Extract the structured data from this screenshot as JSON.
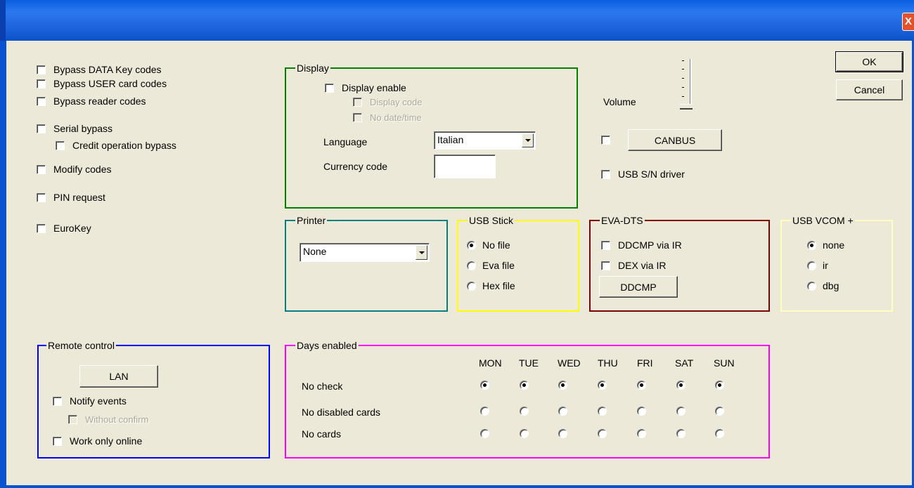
{
  "window": {
    "close_glyph": "X"
  },
  "buttons": {
    "ok": "OK",
    "cancel": "Cancel",
    "canbus": "CANBUS",
    "ddcmp": "DDCMP",
    "lan": "LAN"
  },
  "bypass": [
    {
      "label": "Bypass DATA Key codes",
      "checked": false
    },
    {
      "label": "Bypass USER card codes",
      "checked": false
    },
    {
      "label": "Bypass reader codes",
      "checked": false
    },
    {
      "label": "Serial bypass",
      "checked": false
    },
    {
      "label": "Credit operation bypass",
      "checked": false
    },
    {
      "label": "Modify codes",
      "checked": false
    },
    {
      "label": "PIN request",
      "checked": false
    },
    {
      "label": "EuroKey",
      "checked": false
    }
  ],
  "display": {
    "group_label": "Display",
    "enable_label": "Display enable",
    "display_code_label": "Display code",
    "no_datetime_label": "No date/time",
    "language_label": "Language",
    "language_value": "Italian",
    "currency_label": "Currency code",
    "currency_value": ""
  },
  "volume": {
    "label": "Volume",
    "level": 1.0
  },
  "canbus_check": false,
  "usb_sn": {
    "label": "USB S/N driver",
    "checked": false
  },
  "printer": {
    "group_label": "Printer",
    "value": "None"
  },
  "usb_stick": {
    "group_label": "USB Stick",
    "options": [
      "No file",
      "Eva file",
      "Hex file"
    ],
    "selected": "No file"
  },
  "eva_dts": {
    "group_label": "EVA-DTS",
    "ddcmp_ir_label": "DDCMP via IR",
    "dex_ir_label": "DEX via IR"
  },
  "usb_vcom": {
    "group_label": "USB VCOM +",
    "options": [
      "none",
      "ir",
      "dbg"
    ],
    "selected": "none"
  },
  "remote": {
    "group_label": "Remote control",
    "notify_label": "Notify events",
    "without_confirm_label": "Without confirm",
    "work_online_label": "Work only online"
  },
  "days": {
    "group_label": "Days enabled",
    "columns": [
      "MON",
      "TUE",
      "WED",
      "THU",
      "FRI",
      "SAT",
      "SUN"
    ],
    "rows": [
      "No check",
      "No disabled cards",
      "No cards"
    ],
    "selected_row": "No check"
  },
  "colors": {
    "display": "#008000",
    "printer": "#008080",
    "usb_stick": "#ffff00",
    "eva_dts": "#800000",
    "usb_vcom": "#ffffc0",
    "remote": "#0000ff",
    "days": "#ff00ff"
  }
}
